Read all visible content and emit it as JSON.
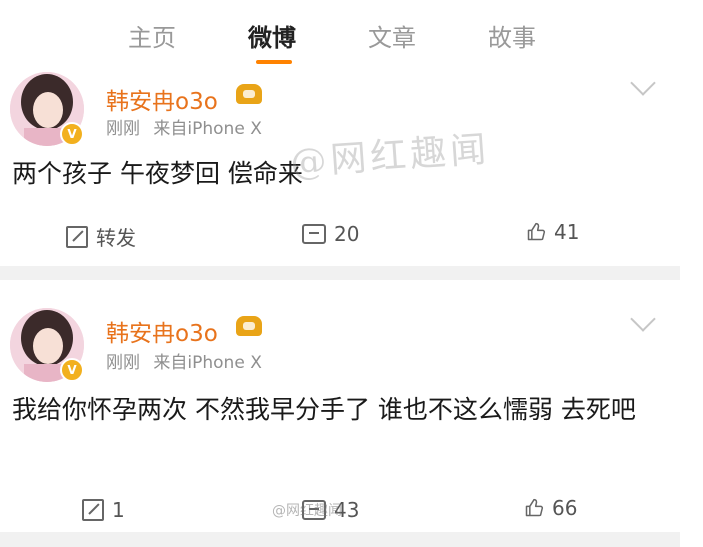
{
  "tabs": [
    {
      "label": "主页"
    },
    {
      "label": "微博"
    },
    {
      "label": "文章"
    },
    {
      "label": "故事"
    }
  ],
  "posts": [
    {
      "username": "韩安冉o3o",
      "time": "刚刚",
      "source": "来自iPhone X",
      "text": "两个孩子 午夜梦回 偿命来",
      "share_label": "转发",
      "comments": "20",
      "likes": "41"
    },
    {
      "username": "韩安冉o3o",
      "time": "刚刚",
      "source": "来自iPhone X",
      "text": "我给你怀孕两次 不然我早分手了 谁也不这么懦弱 去死吧",
      "share_label": "1",
      "comments": "43",
      "likes": "66"
    }
  ],
  "watermarks": [
    "@网红趣闻",
    "@网红趣闻"
  ],
  "colors": {
    "accent": "#ff8200",
    "username": "#e8731c",
    "vip": "#e9a417"
  },
  "icons": [
    "share-icon",
    "comment-icon",
    "like-icon",
    "chevron-down-icon",
    "verified-badge-icon",
    "vip-crown-icon"
  ]
}
